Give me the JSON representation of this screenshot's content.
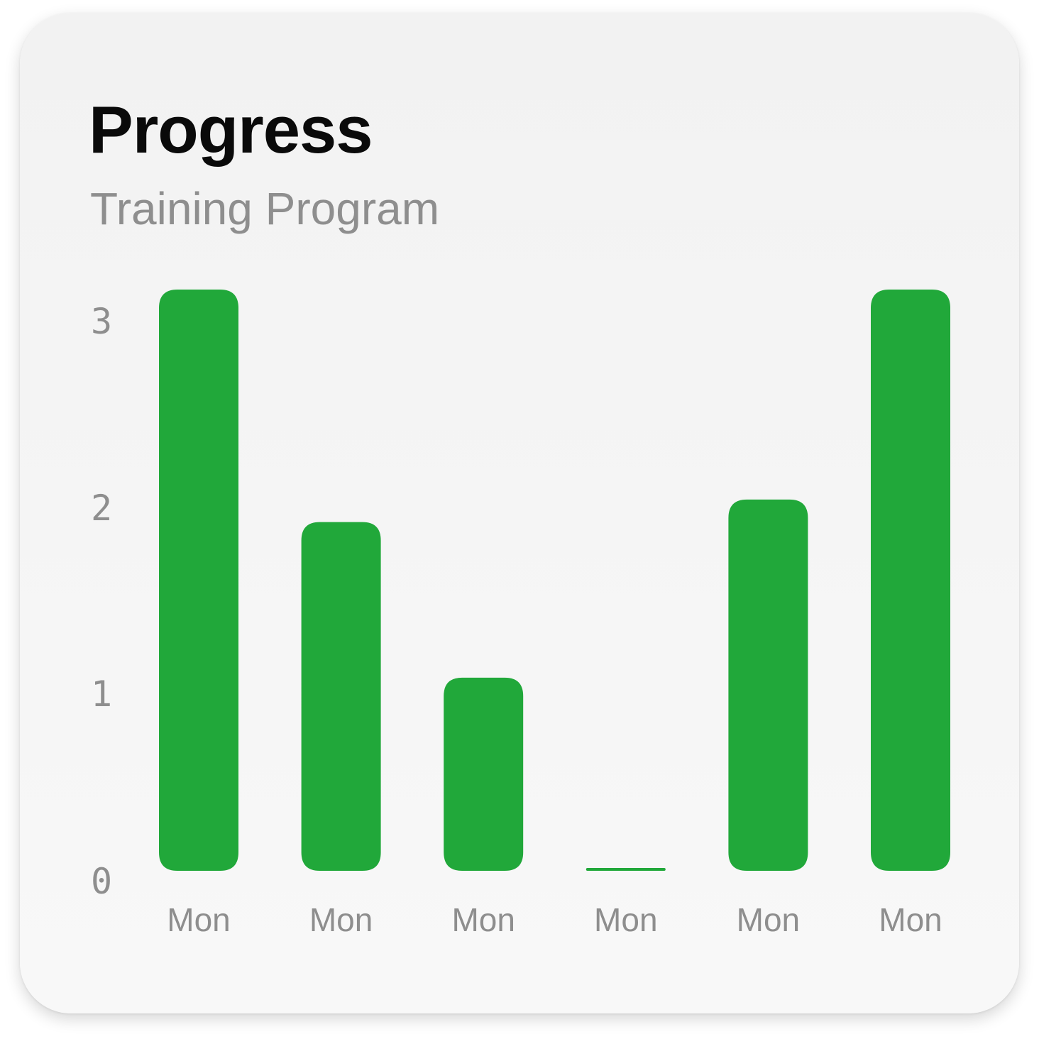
{
  "header": {
    "title": "Progress",
    "subtitle": "Training Program"
  },
  "colors": {
    "bar": "#21a83a",
    "card_background": "#f4f4f4",
    "title": "#0a0a0a",
    "muted_text": "#8e8e8e"
  },
  "chart_data": {
    "type": "bar",
    "title": "Progress",
    "subtitle": "Training Program",
    "categories": [
      "Mon",
      "Mon",
      "Mon",
      "Mon",
      "Mon",
      "Mon"
    ],
    "values": [
      3.1,
      1.86,
      1.03,
      0,
      1.98,
      3.1
    ],
    "yticks": [
      0,
      1,
      2,
      3
    ],
    "ylim": [
      0,
      3.1
    ],
    "grid": false,
    "legend": "none"
  }
}
